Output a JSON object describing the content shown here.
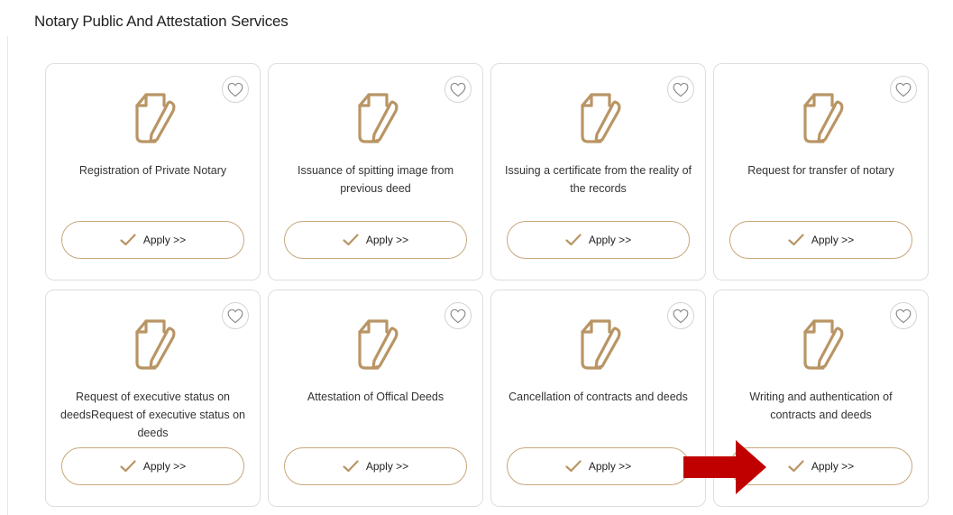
{
  "section": {
    "title": "Notary Public And Attestation Services"
  },
  "cards": [
    {
      "title": "Registration of Private Notary",
      "apply_label": "Apply >>"
    },
    {
      "title": "Issuance of spitting image from previous deed",
      "apply_label": "Apply >>"
    },
    {
      "title": "Issuing a certificate from the reality of the records",
      "apply_label": "Apply >>"
    },
    {
      "title": "Request for transfer of notary",
      "apply_label": "Apply >>"
    },
    {
      "title": "Request of executive status on deedsRequest of executive status on deeds",
      "apply_label": "Apply >>"
    },
    {
      "title": "Attestation of Offical Deeds",
      "apply_label": "Apply >>"
    },
    {
      "title": "Cancellation of contracts and deeds",
      "apply_label": "Apply >>"
    },
    {
      "title": "Writing and authentication of contracts and deeds",
      "apply_label": "Apply >>"
    }
  ],
  "icons": {
    "favorite": "heart-icon",
    "service": "document-pen-icon",
    "apply": "check-icon",
    "annotation": "red-arrow-icon"
  },
  "colors": {
    "accent_gold": "#b99565",
    "button_border": "#c7a77c",
    "annotation_red": "#c00000"
  }
}
